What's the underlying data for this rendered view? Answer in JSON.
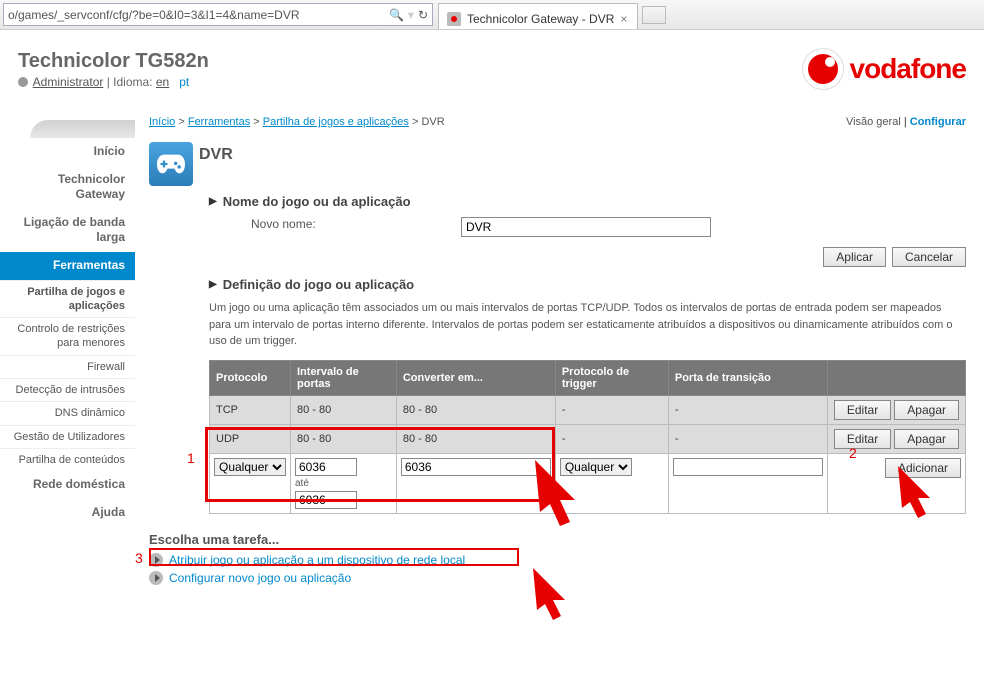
{
  "browser": {
    "url": "o/games/_servconf/cfg/?be=0&I0=3&I1=4&name=DVR",
    "search_icon": "🔍",
    "refresh_icon": "↻",
    "tab_title": "Technicolor Gateway - DVR",
    "tab_close": "×"
  },
  "header": {
    "device": "Technicolor TG582n",
    "user": "Administrator",
    "lang_label": "Idioma:",
    "lang_en": "en",
    "lang_pt": "pt",
    "brand": "vodafone"
  },
  "sidebar": {
    "items": [
      "Início",
      "Technicolor Gateway",
      "Ligação de banda larga",
      "Ferramentas",
      "Rede doméstica",
      "Ajuda"
    ],
    "sub_items": [
      "Partilha de jogos e aplicações",
      "Controlo de restrições para menores",
      "Firewall",
      "Detecção de intrusões",
      "DNS dinâmico",
      "Gestão de Utilizadores",
      "Partilha de conteúdos"
    ]
  },
  "breadcrumb": {
    "home": "Início",
    "tools": "Ferramentas",
    "sharing": "Partilha de jogos e aplicações",
    "current": "DVR",
    "overview": "Visão geral",
    "configure": "Configurar"
  },
  "main": {
    "title": "DVR",
    "section1": "Nome do jogo ou da aplicação",
    "new_name_label": "Novo nome:",
    "new_name_value": "DVR",
    "apply": "Aplicar",
    "cancel": "Cancelar",
    "section2": "Definição do jogo ou aplicação",
    "desc": "Um jogo ou uma aplicação têm associados um ou mais intervalos de portas TCP/UDP. Todos os intervalos de portas de entrada podem ser mapeados para um intervalo de portas interno diferente. Intervalos de portas podem ser estaticamente atribuídos a dispositivos ou dinamicamente atribuídos com o uso de um trigger.",
    "headers": {
      "proto": "Protocolo",
      "range": "Intervalo de portas",
      "convert": "Converter em...",
      "trigger_proto": "Protocolo de trigger",
      "trigger_port": "Porta de transição"
    },
    "rows": [
      {
        "proto": "TCP",
        "range": "80 - 80",
        "convert": "80 - 80",
        "tproto": "-",
        "tport": "-"
      },
      {
        "proto": "UDP",
        "range": "80 - 80",
        "convert": "80 - 80",
        "tproto": "-",
        "tport": "-"
      }
    ],
    "edit": "Editar",
    "delete": "Apagar",
    "input": {
      "proto": "Qualquer",
      "port_from": "6036",
      "port_to_label": "até",
      "port_to": "6036",
      "convert": "6036",
      "trigger_proto": "Qualquer",
      "trigger_port": ""
    },
    "add": "Adicionar"
  },
  "tasks": {
    "heading": "Escolha uma tarefa...",
    "t1": "Atribuir jogo ou aplicação a um dispositivo de rede local",
    "t2": "Configurar novo jogo ou aplicação"
  },
  "annotations": {
    "n1": "1",
    "n2": "2",
    "n3": "3"
  }
}
